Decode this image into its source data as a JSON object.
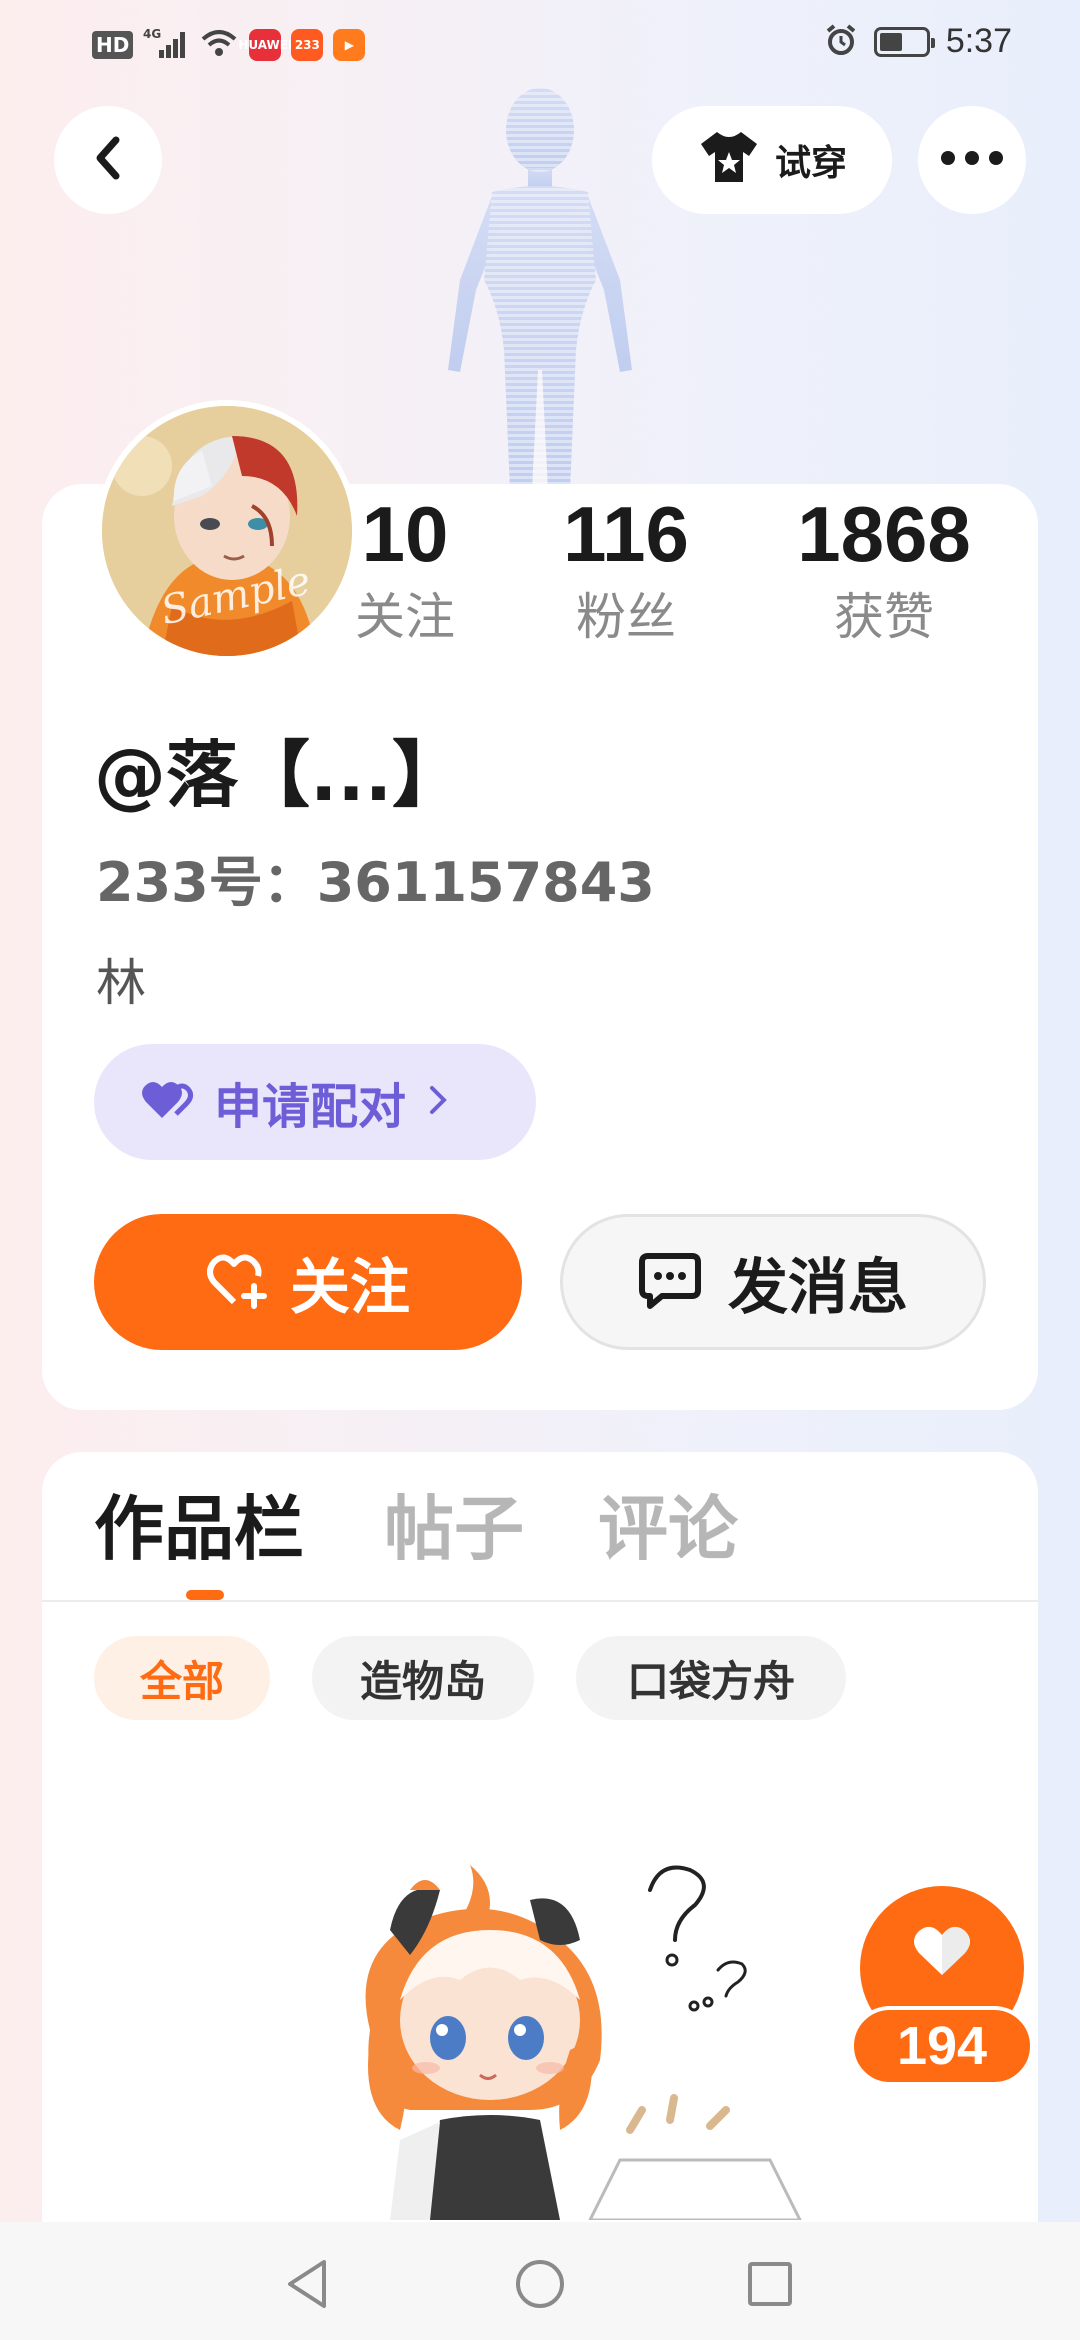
{
  "status_bar": {
    "time": "5:37",
    "hd_label": "HD",
    "network_label": "4G",
    "apps": [
      {
        "name": "huawei-app-icon",
        "label": "HUAWEI",
        "color": "#e8303a"
      },
      {
        "name": "app-233-icon",
        "label": "233",
        "color": "#ff5a1f"
      },
      {
        "name": "video-app-icon",
        "label": "▶",
        "color": "#ff7b1c"
      }
    ]
  },
  "header": {
    "try_on_label": "试穿"
  },
  "profile": {
    "avatar_watermark": "Sample",
    "stats": [
      {
        "value": "10",
        "label": "关注"
      },
      {
        "value": "116",
        "label": "粉丝"
      },
      {
        "value": "1868",
        "label": "获赞"
      }
    ],
    "nickname": "@落【...】",
    "user_id": "233号：361157843",
    "bio": "林",
    "pair_button_label": "申请配对",
    "follow_button_label": "关注",
    "message_button_label": "发消息"
  },
  "works": {
    "tabs": [
      {
        "label": "作品栏",
        "active": true
      },
      {
        "label": "帖子",
        "active": false
      },
      {
        "label": "评论",
        "active": false
      }
    ],
    "filters": [
      {
        "label": "全部",
        "active": true
      },
      {
        "label": "造物岛",
        "active": false
      },
      {
        "label": "口袋方舟",
        "active": false
      }
    ],
    "like_count": "194"
  },
  "colors": {
    "accent": "#ff6b12",
    "pair": "#6d5ed8",
    "pair_bg": "#e9e6fc"
  }
}
